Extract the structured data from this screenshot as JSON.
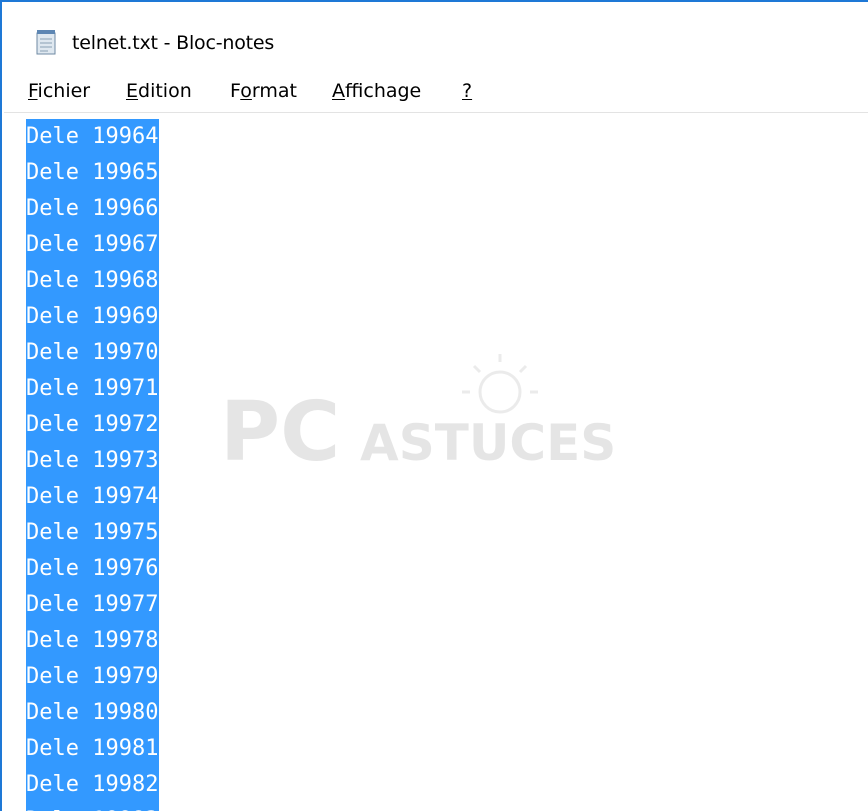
{
  "window": {
    "title": "telnet.txt - Bloc-notes",
    "app_icon": "notepad-icon",
    "accent_color": "#1e78d6"
  },
  "menubar": {
    "items": [
      {
        "label_first": "F",
        "label_rest": "ichier"
      },
      {
        "label_first": "E",
        "label_rest": "dition"
      },
      {
        "label_pre": "F",
        "label_under": "o",
        "label_post": "rmat"
      },
      {
        "label_first": "A",
        "label_rest": "ffichage"
      },
      {
        "label_first": "?",
        "label_rest": ""
      }
    ]
  },
  "editor": {
    "selection_color": "#3399ff",
    "lines": [
      "Dele 19964",
      "Dele 19965",
      "Dele 19966",
      "Dele 19967",
      "Dele 19968",
      "Dele 19969",
      "Dele 19970",
      "Dele 19971",
      "Dele 19972",
      "Dele 19973",
      "Dele 19974",
      "Dele 19975",
      "Dele 19976",
      "Dele 19977",
      "Dele 19978",
      "Dele 19979",
      "Dele 19980",
      "Dele 19981",
      "Dele 19982"
    ]
  },
  "watermark": {
    "text_big": "PC",
    "text_small": "ASTUCES",
    "icon": "lightbulb-icon"
  }
}
